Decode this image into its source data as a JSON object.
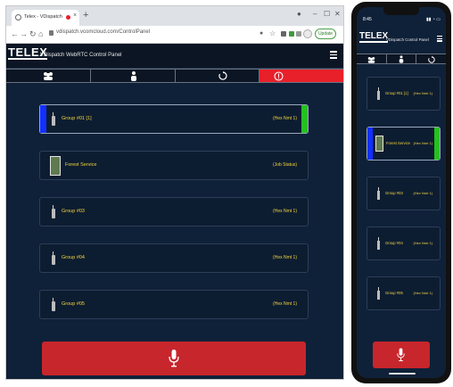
{
  "browser": {
    "tab_title": "Telex - VDispatch",
    "url": "vdispatch.vcomcloud.com/ControlPanel",
    "update_label": "Update"
  },
  "app": {
    "logo": "TELEX",
    "title": "VDispatch WebRTC Control Panel"
  },
  "groups": [
    {
      "name": "Group #01  [1]",
      "status": "(Hex Nmt 1)"
    },
    {
      "name": "Forest Service",
      "status": "(Job Status)"
    },
    {
      "name": "Group #03",
      "status": "(Hex Nmt 1)"
    },
    {
      "name": "Group #04",
      "status": "(Hex Nmt 1)"
    },
    {
      "name": "Group #05",
      "status": "(Hex Nmt 1)"
    }
  ],
  "phone": {
    "time": "8:45",
    "logo": "TELEX",
    "title": "VDispatch Control Panel",
    "groups": [
      {
        "name": "Group #01  [1]",
        "status": "(Hex Nmt 1)"
      },
      {
        "name": "Forest Service",
        "status": "(Hex Nmt 1)"
      },
      {
        "name": "Group #03",
        "status": "(Hex Nmt 1)"
      },
      {
        "name": "Group #04",
        "status": "(Hex Nmt 1)"
      },
      {
        "name": "Group #05",
        "status": "(Hex Nmt 1)"
      }
    ]
  },
  "colors": {
    "accent_red": "#e8202a",
    "ptt_red": "#c7262c",
    "group_text": "#f1d33c",
    "tx_blue": "#1230ff",
    "rx_green": "#26c021",
    "panel_bg": "#0f2138"
  },
  "icons": {
    "toolbar": [
      "group-icon",
      "person-icon",
      "refresh-icon",
      "alert-icon"
    ],
    "ptt": "microphone-icon",
    "group": "radio-icon",
    "forest": "forest-service-badge-icon"
  }
}
